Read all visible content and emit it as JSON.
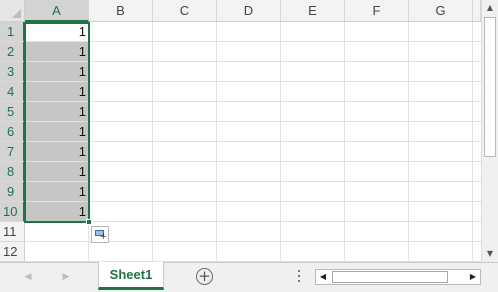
{
  "columns": [
    "A",
    "B",
    "C",
    "D",
    "E",
    "F",
    "G"
  ],
  "selected_column": "A",
  "rows": [
    "1",
    "2",
    "3",
    "4",
    "5",
    "6",
    "7",
    "8",
    "9",
    "10",
    "11",
    "12"
  ],
  "cells_A": [
    "1",
    "1",
    "1",
    "1",
    "1",
    "1",
    "1",
    "1",
    "1",
    "1"
  ],
  "sheet_tab": "Sheet1",
  "icons": {
    "add_sheet": "plus-circle-icon",
    "quick_analysis": "quick-analysis-icon",
    "scroll_up": "triangle-up-icon",
    "scroll_down": "triangle-down-icon",
    "scroll_left": "triangle-left-icon",
    "scroll_right": "triangle-right-icon"
  },
  "colors": {
    "accent": "#217346",
    "selected_header": "#d3d3d3",
    "selected_cells": "#c6c6c6"
  }
}
